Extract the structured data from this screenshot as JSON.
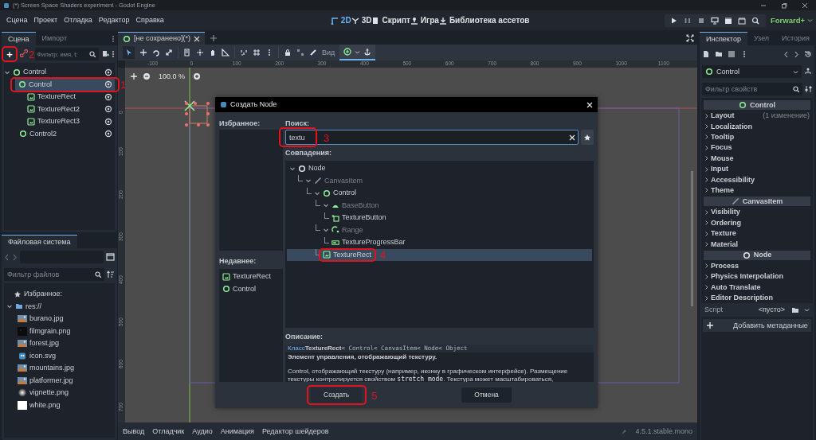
{
  "window": {
    "title": "(*) Screen Space Shaders experiment - Godot Engine"
  },
  "menu": [
    "Сцена",
    "Проект",
    "Отладка",
    "Редактор",
    "Справка"
  ],
  "workspaces": [
    {
      "label": "2D",
      "kind": "planar",
      "selected": true
    },
    {
      "label": "3D",
      "kind": "spatial",
      "selected": false
    },
    {
      "label": "Скрипт",
      "kind": "script",
      "selected": false
    },
    {
      "label": "Игра",
      "kind": "game",
      "selected": false
    },
    {
      "label": "Библиотека ассетов",
      "kind": "assetlib",
      "selected": false
    }
  ],
  "renderer": "Forward+",
  "scene_dock": {
    "tabs": [
      {
        "label": "Сцена",
        "selected": true
      },
      {
        "label": "Импорт",
        "selected": false
      }
    ],
    "add_button": {
      "label": "+",
      "highlighted": true
    },
    "link_annotation": "2",
    "filter_placeholder": "Фильтр: имя, t:",
    "tree": [
      {
        "name": "Control",
        "kind": "control",
        "selected": false,
        "children": [
          {
            "name": "Control",
            "kind": "control",
            "selected": true,
            "annotation": "1",
            "children": [
              {
                "name": "TextureRect",
                "kind": "texture",
                "selected": false
              },
              {
                "name": "TextureRect2",
                "kind": "texture",
                "selected": false
              },
              {
                "name": "TextureRect3",
                "kind": "texture",
                "selected": false
              }
            ]
          },
          {
            "name": "Control2",
            "kind": "control",
            "selected": false
          }
        ]
      }
    ]
  },
  "filesystem": {
    "tab": "Файловая система",
    "filter_placeholder": "Фильтр файлов",
    "favorites": "Избранное:",
    "root": "res://",
    "files": [
      {
        "name": "burano.jpg",
        "kind": "photo"
      },
      {
        "name": "filmgrain.png",
        "kind": "dark"
      },
      {
        "name": "forest.jpg",
        "kind": "photo"
      },
      {
        "name": "icon.svg",
        "kind": "svg"
      },
      {
        "name": "mountains.jpg",
        "kind": "photo"
      },
      {
        "name": "platformer.jpg",
        "kind": "photo"
      },
      {
        "name": "vignette.png",
        "kind": "radial"
      },
      {
        "name": "white.png",
        "kind": "white"
      }
    ]
  },
  "editor_tab": {
    "label": "[не сохранено](*)"
  },
  "view_menu": "Вид",
  "zoom": "100.0 %",
  "rulers": {
    "horizontal": [
      "-100",
      "0",
      "100",
      "200",
      "300",
      "400",
      "500",
      "600",
      "700",
      "800",
      "900",
      "1000",
      "1100"
    ],
    "vertical": [
      "0",
      "100",
      "200",
      "300",
      "400",
      "500",
      "600",
      "700"
    ]
  },
  "bottom_tabs": [
    "Вывод",
    "Отладчик",
    "Аудио",
    "Анимация",
    "Редактор шейдеров"
  ],
  "version": "4.5.1.stable.mono",
  "inspector": {
    "tabs": [
      {
        "label": "Инспектор",
        "selected": true
      },
      {
        "label": "Узел",
        "selected": false
      },
      {
        "label": "История",
        "selected": false
      }
    ],
    "node": "Control",
    "filter_placeholder": "Фильтр свойств",
    "sections": [
      {
        "title": "Control",
        "kind": "control",
        "groups": [
          {
            "name": "Layout",
            "note": "(1 изменение)"
          },
          {
            "name": "Localization"
          },
          {
            "name": "Tooltip"
          },
          {
            "name": "Focus"
          },
          {
            "name": "Mouse"
          },
          {
            "name": "Input"
          },
          {
            "name": "Accessibility"
          },
          {
            "name": "Theme"
          }
        ]
      },
      {
        "title": "CanvasItem",
        "kind": "canvasitem",
        "groups": [
          {
            "name": "Visibility"
          },
          {
            "name": "Ordering"
          },
          {
            "name": "Texture"
          },
          {
            "name": "Material"
          }
        ]
      },
      {
        "title": "Node",
        "kind": "node",
        "groups": [
          {
            "name": "Process"
          },
          {
            "name": "Physics Interpolation"
          },
          {
            "name": "Auto Translate"
          },
          {
            "name": "Editor Description"
          }
        ]
      }
    ],
    "script": {
      "label": "Script",
      "value": "<пусто>"
    },
    "add_metadata": "Добавить метаданные"
  },
  "dialog": {
    "title": "Создать Node",
    "favorites_label": "Избранное:",
    "recent_label": "Недавнее:",
    "recent": [
      {
        "name": "TextureRect",
        "kind": "texture"
      },
      {
        "name": "Control",
        "kind": "control"
      }
    ],
    "search_label": "Поиск:",
    "search_value": "textu",
    "search_annotation": "3",
    "matches_label": "Совпадения:",
    "matches": [
      {
        "name": "Node",
        "kind": "node",
        "disabled": false,
        "selected": false,
        "children": [
          {
            "name": "CanvasItem",
            "kind": "canvasitem",
            "disabled": true,
            "selected": false,
            "children": [
              {
                "name": "Control",
                "kind": "control",
                "disabled": false,
                "selected": false,
                "children": [
                  {
                    "name": "BaseButton",
                    "kind": "basebutton",
                    "disabled": true,
                    "selected": false,
                    "children": [
                      {
                        "name": "TextureButton",
                        "kind": "texturebutton",
                        "disabled": false,
                        "selected": false
                      }
                    ]
                  },
                  {
                    "name": "Range",
                    "kind": "range",
                    "disabled": true,
                    "selected": false,
                    "children": [
                      {
                        "name": "TextureProgressBar",
                        "kind": "progressbar",
                        "disabled": false,
                        "selected": false
                      }
                    ]
                  },
                  {
                    "name": "TextureRect",
                    "kind": "texture",
                    "disabled": false,
                    "selected": true,
                    "annotation": "4"
                  }
                ]
              }
            ]
          }
        ]
      }
    ],
    "description_label": "Описание:",
    "class_keyword": "Класс",
    "class_name": "TextureRect",
    "inherits": [
      "< Control",
      "< CanvasItem",
      "< Node",
      "< Object"
    ],
    "summary": "Элемент управления, отображающий текстуру.",
    "text_before": "Control, отображающий текстуру (например, иконку в графическом интерфейсе). Размещение текстуры контролируется свойством ",
    "code": "stretch_mode",
    "text_after": ". Текстура может масштабироваться,",
    "buttons": [
      {
        "label": "Создать",
        "kind": "primary",
        "annotation": "5"
      },
      {
        "label": "Отмена",
        "kind": "secondary"
      }
    ]
  }
}
